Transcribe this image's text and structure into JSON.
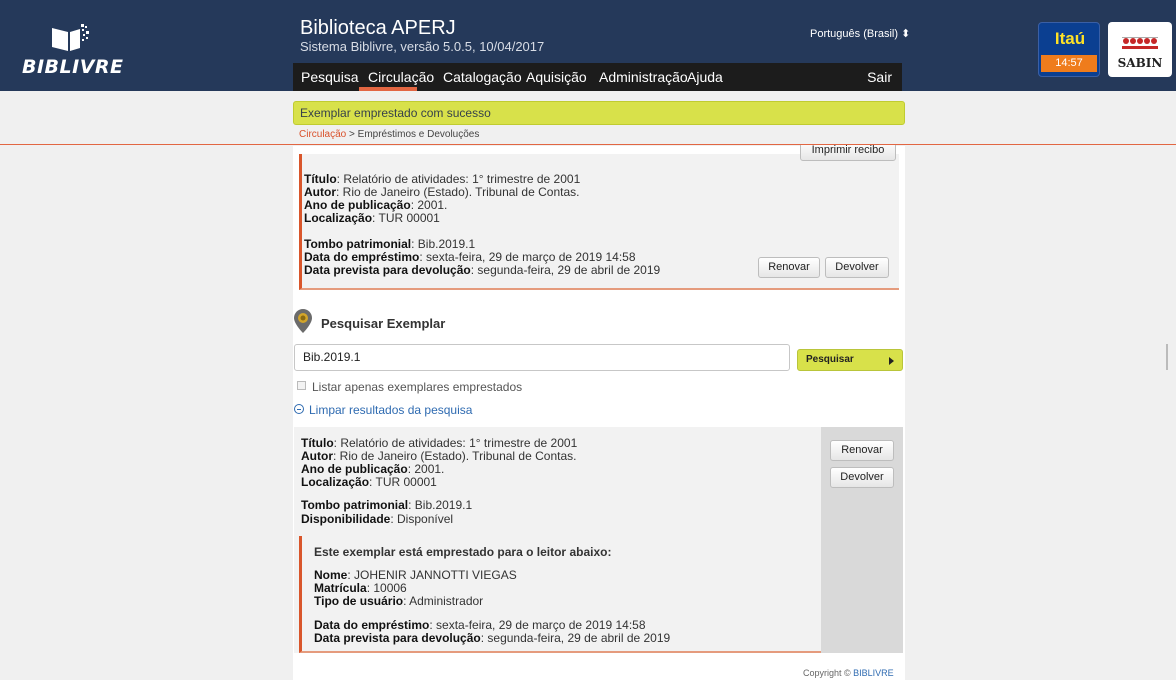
{
  "header": {
    "logo_text": "BIBLIVRE",
    "title": "Biblioteca APERJ",
    "subtitle": "Sistema Biblivre, versão 5.0.5, 10/04/2017",
    "language": "Português (Brasil) ⬍",
    "nav": [
      "Pesquisa",
      "Circulação",
      "Catalogação",
      "Aquisição",
      "Administração",
      "Ajuda"
    ],
    "logout": "Sair",
    "itau": {
      "name": "Itaú",
      "time": "14:57"
    },
    "sabin": {
      "name": "SABIN"
    }
  },
  "message": "Exemplar emprestado com sucesso",
  "breadcrumb": {
    "link": "Circulação",
    "separator": " > ",
    "current": "Empréstimos e Devoluções"
  },
  "loan_card": {
    "print_button": "Imprimir recibo",
    "titulo_label": "Título",
    "titulo": ": Relatório de atividades: 1° trimestre de 2001",
    "autor_label": "Autor",
    "autor": ": Rio de Janeiro (Estado). Tribunal de Contas.",
    "ano_label": "Ano de publicação",
    "ano": ": 2001.",
    "localizacao_label": "Localização",
    "localizacao": ": TUR 00001",
    "tombo_label": "Tombo patrimonial",
    "tombo": ": Bib.2019.1",
    "data_emp_label": "Data do empréstimo",
    "data_emp": ": sexta-feira, 29 de março de 2019 14:58",
    "data_prev_label": "Data prevista para devolução",
    "data_prev": ": segunda-feira, 29 de abril de 2019",
    "renew_button": "Renovar",
    "return_button": "Devolver"
  },
  "search": {
    "title": "Pesquisar Exemplar",
    "value": "Bib.2019.1",
    "button": "Pesquisar",
    "checkbox_label": "Listar apenas exemplares emprestados",
    "clear_label": "Limpar resultados da pesquisa"
  },
  "result": {
    "titulo_label": "Título",
    "titulo": ": Relatório de atividades: 1° trimestre de 2001",
    "autor_label": "Autor",
    "autor": ": Rio de Janeiro (Estado). Tribunal de Contas.",
    "ano_label": "Ano de publicação",
    "ano": ": 2001.",
    "localizacao_label": "Localização",
    "localizacao": ": TUR 00001",
    "tombo_label": "Tombo patrimonial",
    "tombo": ": Bib.2019.1",
    "disp_label": "Disponibilidade",
    "disp": ": Disponível",
    "renew_button": "Renovar",
    "return_button": "Devolver",
    "reader_heading": "Este exemplar está emprestado para o leitor abaixo:",
    "nome_label": "Nome",
    "nome": ": JOHENIR JANNOTTI VIEGAS",
    "matricula_label": "Matrícula",
    "matricula": ": 10006",
    "tipo_label": "Tipo de usuário",
    "tipo": ": Administrador",
    "data_emp_label": "Data do empréstimo",
    "data_emp": ": sexta-feira, 29 de março de 2019 14:58",
    "data_prev_label": "Data prevista para devolução",
    "data_prev": ": segunda-feira, 29 de abril de 2019"
  },
  "footer": {
    "copyright": "Copyright © ",
    "link": "BIBLIVRE"
  }
}
